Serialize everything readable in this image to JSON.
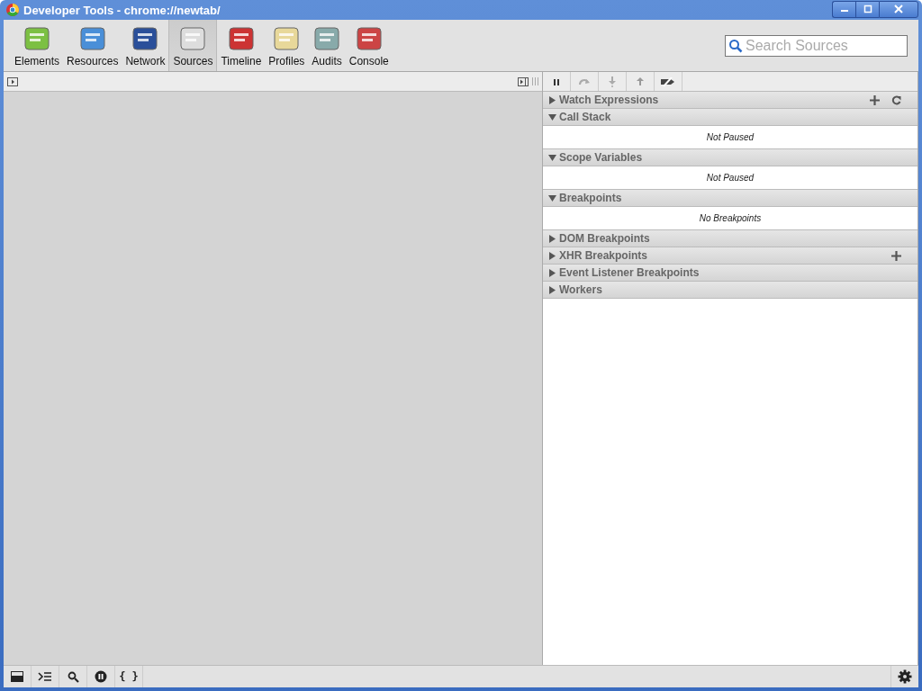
{
  "window": {
    "title": "Developer Tools - chrome://newtab/"
  },
  "tabs": [
    {
      "label": "Elements",
      "selected": false
    },
    {
      "label": "Resources",
      "selected": false
    },
    {
      "label": "Network",
      "selected": false
    },
    {
      "label": "Sources",
      "selected": true
    },
    {
      "label": "Timeline",
      "selected": false
    },
    {
      "label": "Profiles",
      "selected": false
    },
    {
      "label": "Audits",
      "selected": false
    },
    {
      "label": "Console",
      "selected": false
    }
  ],
  "search": {
    "placeholder": "Search Sources"
  },
  "sections": [
    {
      "title": "Watch Expressions",
      "expanded": false,
      "buttons": [
        {
          "kind": "add"
        },
        {
          "kind": "refresh"
        }
      ]
    },
    {
      "title": "Call Stack",
      "expanded": true,
      "message": "Not Paused"
    },
    {
      "title": "Scope Variables",
      "expanded": true,
      "message": "Not Paused"
    },
    {
      "title": "Breakpoints",
      "expanded": true,
      "message": "No Breakpoints"
    },
    {
      "title": "DOM Breakpoints",
      "expanded": false
    },
    {
      "title": "XHR Breakpoints",
      "expanded": false,
      "buttons": [
        {
          "kind": "add"
        }
      ]
    },
    {
      "title": "Event Listener Breakpoints",
      "expanded": false
    },
    {
      "title": "Workers",
      "expanded": false
    }
  ],
  "bottom_bar": {
    "pretty_print": "{ }"
  }
}
